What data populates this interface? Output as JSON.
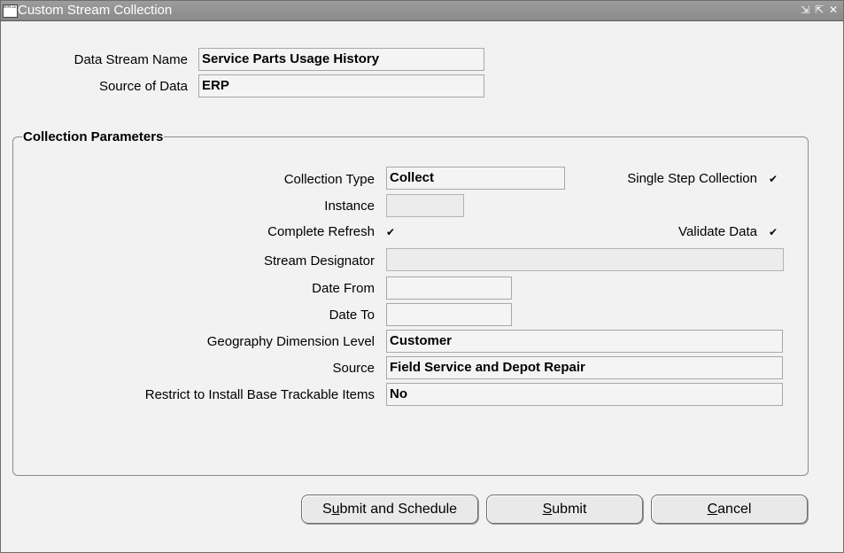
{
  "window": {
    "title": "Custom Stream Collection",
    "app_icon_text": "ORACLE"
  },
  "header": {
    "data_stream_name_label": "Data Stream Name",
    "data_stream_name_value": "Service Parts Usage History",
    "source_of_data_label": "Source of Data",
    "source_of_data_value": "ERP"
  },
  "params": {
    "title": "Collection Parameters",
    "collection_type_label": "Collection Type",
    "collection_type_value": "Collect",
    "single_step_label": "Single Step Collection",
    "single_step_checked": true,
    "instance_label": "Instance",
    "instance_value": "",
    "complete_refresh_label": "Complete Refresh",
    "complete_refresh_checked": true,
    "validate_data_label": "Validate Data",
    "validate_data_checked": true,
    "stream_designator_label": "Stream Designator",
    "stream_designator_value": "",
    "date_from_label": "Date From",
    "date_from_value": "",
    "date_to_label": "Date To",
    "date_to_value": "",
    "geography_label": "Geography Dimension Level",
    "geography_value": "Customer",
    "source_label": "Source",
    "source_value": "Field Service and Depot Repair",
    "restrict_label": "Restrict to Install Base Trackable Items",
    "restrict_value": "No"
  },
  "buttons": {
    "submit_schedule": {
      "pre": "S",
      "mnemonic": "u",
      "post": "bmit and Schedule"
    },
    "submit": {
      "pre": "",
      "mnemonic": "S",
      "post": "ubmit"
    },
    "cancel": {
      "pre": "",
      "mnemonic": "C",
      "post": "ancel"
    }
  },
  "icons": {
    "check": "✔",
    "minimize": "⇲",
    "maximize": "⇱",
    "close": "✕"
  }
}
